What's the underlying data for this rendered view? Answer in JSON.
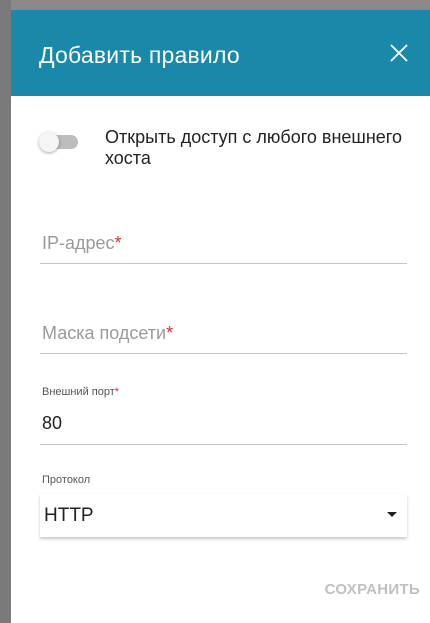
{
  "dialog": {
    "title": "Добавить правило",
    "close_icon": "close-icon"
  },
  "toggle": {
    "label": "Открыть доступ с любого внешнего хоста",
    "checked": false
  },
  "fields": {
    "ip": {
      "placeholder": "IP-адрес",
      "required_mark": "*",
      "value": ""
    },
    "mask": {
      "placeholder": "Маска подсети",
      "required_mark": "*",
      "value": ""
    },
    "port": {
      "label": "Внешний порт",
      "required_mark": "*",
      "value": "80"
    },
    "protocol": {
      "label": "Протокол",
      "value": "HTTP"
    }
  },
  "actions": {
    "save_label": "СОХРАНИТЬ"
  },
  "colors": {
    "header_bg": "#1a88a8",
    "required": "#d32f2f",
    "save_disabled": "#c0c0c0"
  }
}
